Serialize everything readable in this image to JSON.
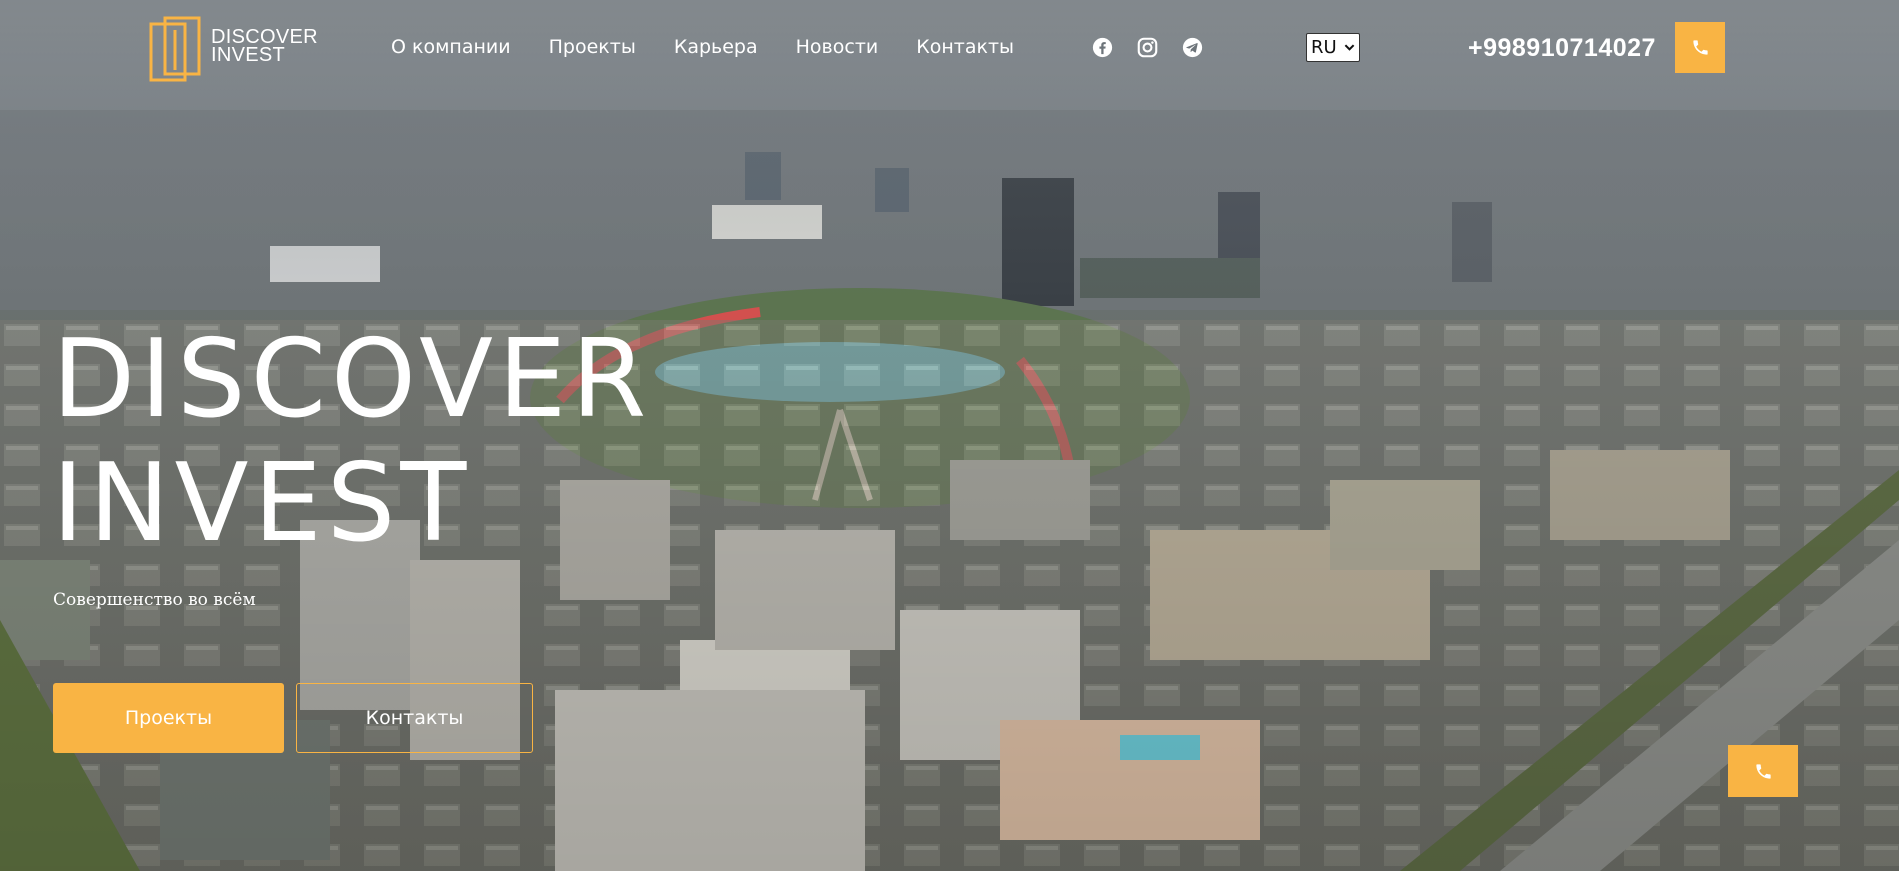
{
  "brand": {
    "logo_line1": "DISCOVER",
    "logo_line2": "INVEST",
    "accent_color": "#f9b444"
  },
  "nav": {
    "items": [
      {
        "label": "О компании"
      },
      {
        "label": "Проекты"
      },
      {
        "label": "Карьера"
      },
      {
        "label": "Новости"
      },
      {
        "label": "Контакты"
      }
    ]
  },
  "social": [
    {
      "icon": "facebook-icon"
    },
    {
      "icon": "instagram-icon"
    },
    {
      "icon": "telegram-icon"
    }
  ],
  "language": {
    "selected": "RU"
  },
  "contact": {
    "phone": "+998910714027",
    "call_icon": "phone-icon"
  },
  "hero": {
    "title_line1": "DISCOVER",
    "title_line2": "INVEST",
    "subtitle": "Совершенство во всём",
    "primary_button": "Проекты",
    "secondary_button": "Контакты"
  },
  "floating_call": {
    "icon": "phone-icon"
  }
}
